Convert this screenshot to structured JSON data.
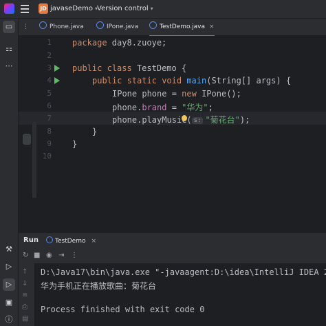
{
  "titlebar": {
    "project_badge": "JD",
    "project_name": "javaseDemo",
    "vcs_label": "Version control"
  },
  "tabs": [
    {
      "label": "Phone.java"
    },
    {
      "label": "IPone.java"
    },
    {
      "label": "TestDemo.java"
    }
  ],
  "editor": {
    "line_numbers": [
      "1",
      "2",
      "3",
      "4",
      "5",
      "6",
      "7",
      "8",
      "9",
      "10"
    ],
    "lines": {
      "l1": {
        "kw": "package",
        "rest": " day8.zuoye;"
      },
      "l3": {
        "kw1": "public",
        "kw2": "class",
        "rest": " TestDemo {"
      },
      "l4": {
        "kw1": "public",
        "kw2": "static",
        "kw3": "void",
        "fn": "main",
        "rest": "(String[] args) {"
      },
      "l5": {
        "a": "IPone phone = ",
        "kw": "new",
        "b": " IPone();"
      },
      "l6": {
        "a": "phone.",
        "field": "brand",
        "b": " = ",
        "str": "\"华为\"",
        "c": ";"
      },
      "l7": {
        "a": "phone.playMusic(",
        "hint": "s:",
        "str": "\"菊花台\"",
        "c": ");"
      },
      "l8": {
        "a": "}"
      },
      "l9": {
        "a": "}"
      }
    }
  },
  "run_panel": {
    "title": "Run",
    "tab_label": "TestDemo",
    "console_lines": [
      "D:\\Java17\\bin\\java.exe \"-javaagent:D:\\idea\\IntelliJ IDEA 2",
      "华为手机正在播放歌曲：菊花台",
      "",
      "Process finished with exit code 0"
    ]
  },
  "icons": [
    "app-logo-icon",
    "menu-icon",
    "folder-icon",
    "structure-icon",
    "more-icon",
    "build-icon",
    "services-icon",
    "run-icon",
    "terminal-icon",
    "problems-icon",
    "git-icon",
    "rerun-icon",
    "stop-icon",
    "camera-icon",
    "exit-icon",
    "more-icon",
    "up-icon",
    "down-icon",
    "wrap-icon",
    "filter-icon",
    "print-icon",
    "trash-icon"
  ],
  "colors": {
    "accent": "#3574f0",
    "keyword": "#cf8e6d",
    "function": "#56a8f5",
    "string": "#6aab73",
    "field": "#c77dbb"
  }
}
